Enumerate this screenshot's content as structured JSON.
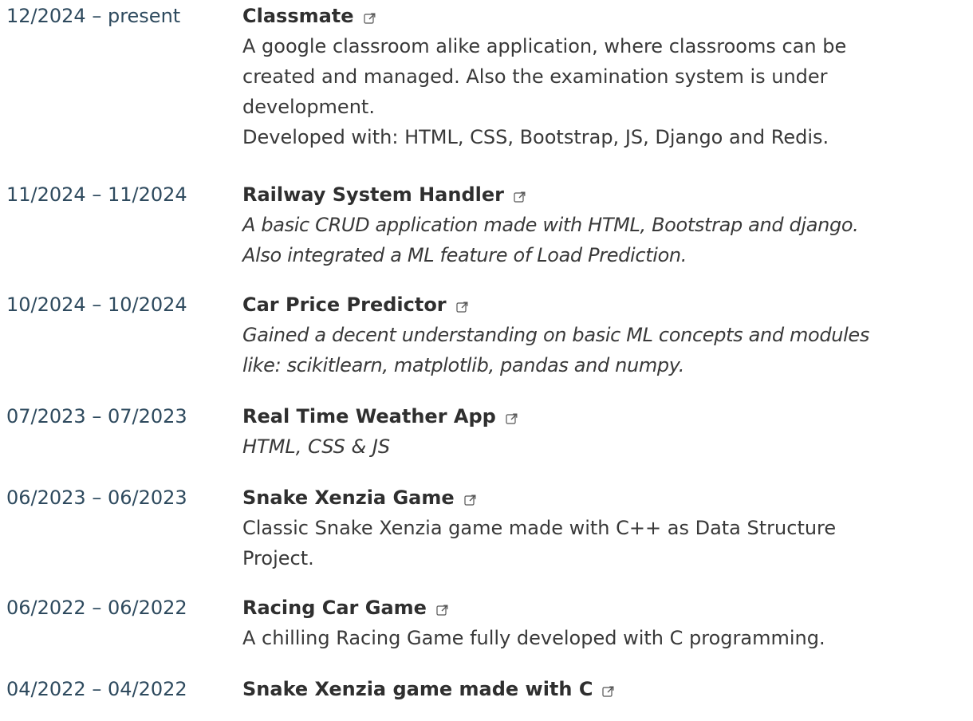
{
  "projects": [
    {
      "dates": "12/2024 – present",
      "title": "Classmate",
      "icon": "external-link-icon",
      "description": [
        "A google classroom alike application, where classrooms can be",
        "created and managed. Also the examination system is under",
        "development.",
        "Developed with: HTML, CSS, Bootstrap, JS, Django and Redis."
      ],
      "italic": false
    },
    {
      "dates": "11/2024 – 11/2024",
      "title": "Railway System Handler",
      "icon": "external-link-icon",
      "description": [
        "A basic CRUD application made with HTML, Bootstrap and django.",
        "Also integrated a ML feature of Load Prediction."
      ],
      "italic": true
    },
    {
      "dates": "10/2024 – 10/2024",
      "title": "Car Price Predictor",
      "icon": "external-link-icon",
      "description": [
        "Gained a decent understanding on basic ML concepts and modules",
        "like: scikitlearn, matplotlib, pandas and numpy."
      ],
      "italic": true
    },
    {
      "dates": "07/2023 – 07/2023",
      "title": "Real Time Weather App",
      "icon": "external-link-icon",
      "description": [
        "HTML, CSS & JS"
      ],
      "italic": true
    },
    {
      "dates": "06/2023 – 06/2023",
      "title": "Snake Xenzia Game",
      "icon": "external-link-icon",
      "description": [
        "Classic Snake Xenzia game made with C++ as Data Structure",
        "Project."
      ],
      "italic": false
    },
    {
      "dates": "06/2022 – 06/2022",
      "title": "Racing Car Game",
      "icon": "external-link-icon",
      "description": [
        "A chilling Racing Game fully developed with C programming."
      ],
      "italic": false
    },
    {
      "dates": "04/2022 – 04/2022",
      "title": "Snake Xenzia game made with C",
      "icon": "external-link-icon",
      "description": [],
      "italic": false
    }
  ]
}
